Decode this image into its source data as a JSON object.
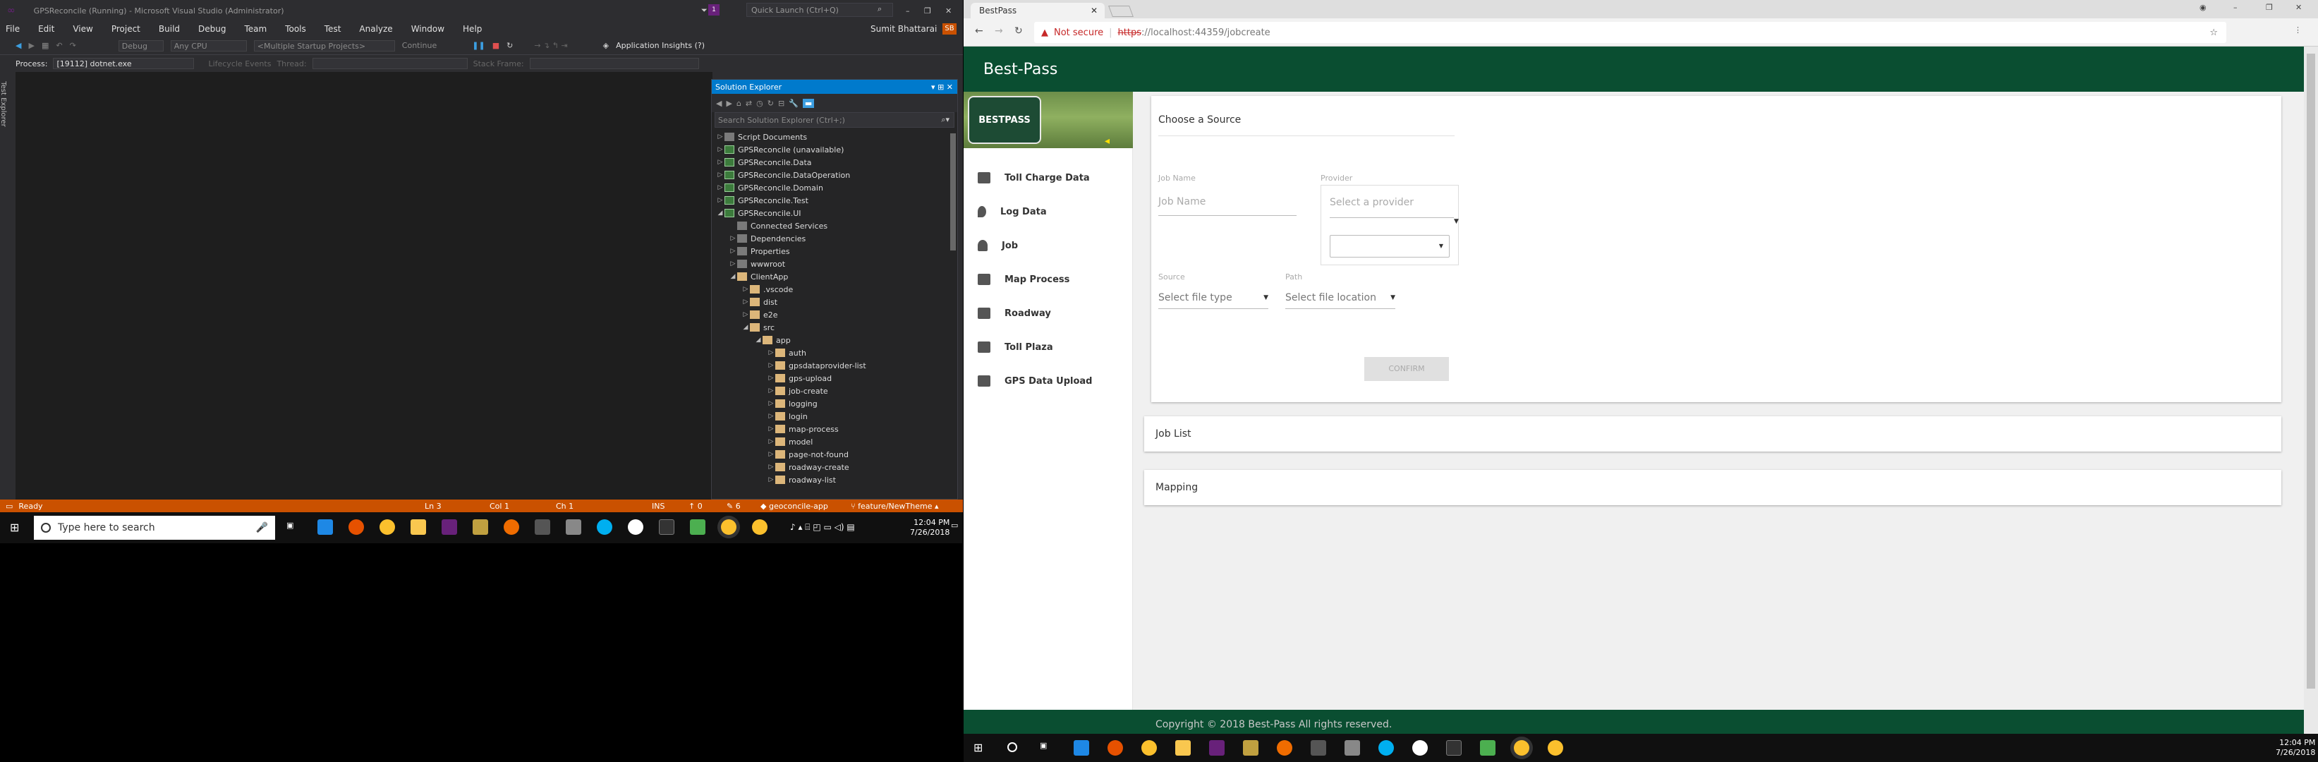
{
  "vs": {
    "title": "GPSReconcile (Running) - Microsoft Visual Studio (Administrator)",
    "quick_launch": "Quick Launch (Ctrl+Q)",
    "user": "Sumit Bhattarai",
    "user_initials": "SB",
    "menu": [
      "File",
      "Edit",
      "View",
      "Project",
      "Build",
      "Debug",
      "Team",
      "Tools",
      "Test",
      "Analyze",
      "Window",
      "Help"
    ],
    "toolbar": {
      "config": "Debug",
      "platform": "Any CPU",
      "startup": "<Multiple Startup Projects>",
      "continue": "Continue",
      "app_insights": "Application Insights (?)"
    },
    "toolbar2": {
      "process_label": "Process:",
      "process_value": "[19112] dotnet.exe",
      "lifecycle": "Lifecycle Events",
      "thread": "Thread:",
      "stack_frame": "Stack Frame:"
    },
    "side_tab": "Test Explorer",
    "solution_explorer": {
      "title": "Solution Explorer",
      "search": "Search Solution Explorer (Ctrl+;)",
      "tree": [
        {
          "label": "Script Documents",
          "indent": 0,
          "icon": "sd",
          "exp": "closed"
        },
        {
          "label": "GPSReconcile (unavailable)",
          "indent": 0,
          "icon": "proj",
          "exp": "closed"
        },
        {
          "label": "GPSReconcile.Data",
          "indent": 0,
          "icon": "proj",
          "exp": "closed"
        },
        {
          "label": "GPSReconcile.DataOperation",
          "indent": 0,
          "icon": "proj",
          "exp": "closed"
        },
        {
          "label": "GPSReconcile.Domain",
          "indent": 0,
          "icon": "proj",
          "exp": "closed"
        },
        {
          "label": "GPSReconcile.Test",
          "indent": 0,
          "icon": "proj",
          "exp": "closed"
        },
        {
          "label": "GPSReconcile.UI",
          "indent": 0,
          "icon": "proj",
          "exp": "open"
        },
        {
          "label": "Connected Services",
          "indent": 1,
          "icon": "sd",
          "exp": "none"
        },
        {
          "label": "Dependencies",
          "indent": 1,
          "icon": "sd",
          "exp": "closed"
        },
        {
          "label": "Properties",
          "indent": 1,
          "icon": "sd",
          "exp": "closed"
        },
        {
          "label": "wwwroot",
          "indent": 1,
          "icon": "sd",
          "exp": "closed"
        },
        {
          "label": "ClientApp",
          "indent": 1,
          "icon": "fold",
          "exp": "open"
        },
        {
          "label": ".vscode",
          "indent": 2,
          "icon": "fold",
          "exp": "closed"
        },
        {
          "label": "dist",
          "indent": 2,
          "icon": "fold",
          "exp": "closed"
        },
        {
          "label": "e2e",
          "indent": 2,
          "icon": "fold",
          "exp": "closed"
        },
        {
          "label": "src",
          "indent": 2,
          "icon": "fold",
          "exp": "open"
        },
        {
          "label": "app",
          "indent": 3,
          "icon": "fold",
          "exp": "open"
        },
        {
          "label": "auth",
          "indent": 4,
          "icon": "fold",
          "exp": "closed"
        },
        {
          "label": "gpsdataprovider-list",
          "indent": 4,
          "icon": "fold",
          "exp": "closed"
        },
        {
          "label": "gps-upload",
          "indent": 4,
          "icon": "fold",
          "exp": "closed"
        },
        {
          "label": "job-create",
          "indent": 4,
          "icon": "fold",
          "exp": "closed"
        },
        {
          "label": "logging",
          "indent": 4,
          "icon": "fold",
          "exp": "closed"
        },
        {
          "label": "login",
          "indent": 4,
          "icon": "fold",
          "exp": "closed"
        },
        {
          "label": "map-process",
          "indent": 4,
          "icon": "fold",
          "exp": "closed"
        },
        {
          "label": "model",
          "indent": 4,
          "icon": "fold",
          "exp": "closed"
        },
        {
          "label": "page-not-found",
          "indent": 4,
          "icon": "fold",
          "exp": "closed"
        },
        {
          "label": "roadway-create",
          "indent": 4,
          "icon": "fold",
          "exp": "closed"
        },
        {
          "label": "roadway-list",
          "indent": 4,
          "icon": "fold",
          "exp": "closed"
        }
      ]
    },
    "status": {
      "ready": "Ready",
      "ln": "Ln 3",
      "col": "Col 1",
      "ch": "Ch 1",
      "ins": "INS",
      "up": "0",
      "edits": "6",
      "repo": "geoconcile-app",
      "branch": "feature/NewTheme"
    }
  },
  "taskbar_left": {
    "search": "Type here to search",
    "time": "12:04 PM",
    "date": "7/26/2018"
  },
  "chrome": {
    "tab_title": "BestPass",
    "not_secure": "Not secure",
    "url_scheme": "https",
    "url_host": "://localhost:44359/jobcreate"
  },
  "app": {
    "brand": "Best-Pass",
    "logo_text": "BESTPASS",
    "nav": [
      {
        "label": "Toll Charge Data",
        "icon": "truck-icon"
      },
      {
        "label": "Log Data",
        "icon": "map-pin-icon"
      },
      {
        "label": "Job",
        "icon": "person-icon"
      },
      {
        "label": "Map Process",
        "icon": "map-icon"
      },
      {
        "label": "Roadway",
        "icon": "road-icon"
      },
      {
        "label": "Toll Plaza",
        "icon": "rss-icon"
      },
      {
        "label": "GPS Data Upload",
        "icon": "road-icon"
      }
    ],
    "card_title": "Choose a Source",
    "job_name_label": "Job Name",
    "job_name_placeholder": "Job Name",
    "provider_label": "Provider",
    "provider_placeholder": "Select a provider",
    "source_label": "Source",
    "source_placeholder": "Select file type",
    "path_label": "Path",
    "path_placeholder": "Select file location",
    "confirm": "CONFIRM",
    "job_list": "Job List",
    "mapping": "Mapping",
    "footer": "Copyright © 2018 Best-Pass All rights reserved."
  },
  "taskbar_right": {
    "time": "12:04 PM",
    "date": "7/26/2018"
  }
}
